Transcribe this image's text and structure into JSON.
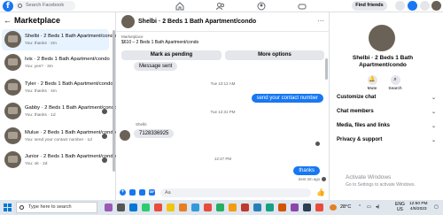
{
  "topbar": {
    "search_placeholder": "Search Facebook",
    "find_friends": "Find friends"
  },
  "sidebar": {
    "title": "Marketplace",
    "chats": [
      {
        "title": "Shelbi · 2 Beds 1 Bath Apartment/condo",
        "subtitle": "You: thanks · 2m",
        "active": true
      },
      {
        "title": "Ivis · 2 Beds 1 Bath Apartment/condo",
        "subtitle": "You: yes? · 3m"
      },
      {
        "title": "Tyler · 2 Beds 1 Bath Apartment/condo",
        "subtitle": "You: thanks · 4m"
      },
      {
        "title": "Gabby · 2 Beds 1 Bath Apartment/condo",
        "subtitle": "You: thanks · 1d"
      },
      {
        "title": "Mulue · 2 Beds 1 Bath Apartment/condo",
        "subtitle": "You: send your contact number · 1d"
      },
      {
        "title": "Junior · 2 Beds 1 Bath Apartment/condo",
        "subtitle": "You: ok · 2d"
      }
    ]
  },
  "chat": {
    "title": "Shelbi · 2 Beds 1 Bath Apartment/condo",
    "marketplace_label": "Marketplace",
    "listing": "$610 – 2 Beds 1 Bath Apartment/condo",
    "mark_pending": "Mark as pending",
    "more_options": "More options",
    "messages": {
      "msg_sent": "Message sent",
      "ts1": "Tue 10:12 AM",
      "out1": "send your contact number",
      "ts2": "Tue 12:31 PM",
      "sender": "Shelbi",
      "in1": "7128336925",
      "ts3": "12:47 PM",
      "out2": "thanks",
      "sent_meta": "Sent 2m ago"
    },
    "composer_placeholder": "Aa"
  },
  "info": {
    "title": "Shelbi · 2 Beds 1 Bath Apartment/condo",
    "mute": "Mute",
    "search": "Search",
    "sections": [
      "Customize chat",
      "Chat members",
      "Media, files and links",
      "Privacy & support"
    ]
  },
  "watermark": {
    "title": "Activate Windows",
    "subtitle": "Go to Settings to activate Windows."
  },
  "taskbar": {
    "search_placeholder": "Type here to search",
    "temperature": "28°C",
    "lang": "ENG",
    "region": "US",
    "time": "12:50 PM",
    "date": "4/9/2023"
  },
  "colors": {
    "accent": "#1877f2",
    "active_chat": "#e7f3ff",
    "panel_bg": "#f0f2f5"
  }
}
